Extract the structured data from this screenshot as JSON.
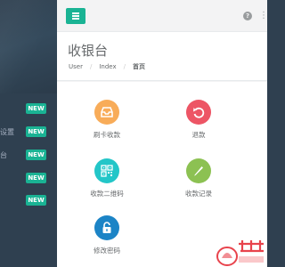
{
  "sidebar": {
    "items": [
      {
        "label": "",
        "badge": "NEW"
      },
      {
        "label": "设置",
        "badge": "NEW"
      },
      {
        "label": "台",
        "badge": "NEW"
      },
      {
        "label": "",
        "badge": "NEW"
      },
      {
        "label": "",
        "badge": "NEW"
      }
    ]
  },
  "topbar": {
    "help_icon": "question-circle",
    "more_icon": "ellipsis"
  },
  "page": {
    "title": "收银台",
    "breadcrumb": [
      "User",
      "Index",
      "首页"
    ]
  },
  "tiles": [
    {
      "label": "刷卡收款",
      "icon": "inbox",
      "color": "#f8ac59"
    },
    {
      "label": "退款",
      "icon": "undo",
      "color": "#ed5565"
    },
    {
      "label": "收款二维码",
      "icon": "qrcode",
      "color": "#23c6c8"
    },
    {
      "label": "收款记录",
      "icon": "pencil",
      "color": "#1ab394"
    },
    {
      "label": "修改密码",
      "icon": "unlock",
      "color": "#1c84c6"
    }
  ],
  "colors": {
    "sidebar": "#2f4050",
    "accent": "#1ab394"
  }
}
